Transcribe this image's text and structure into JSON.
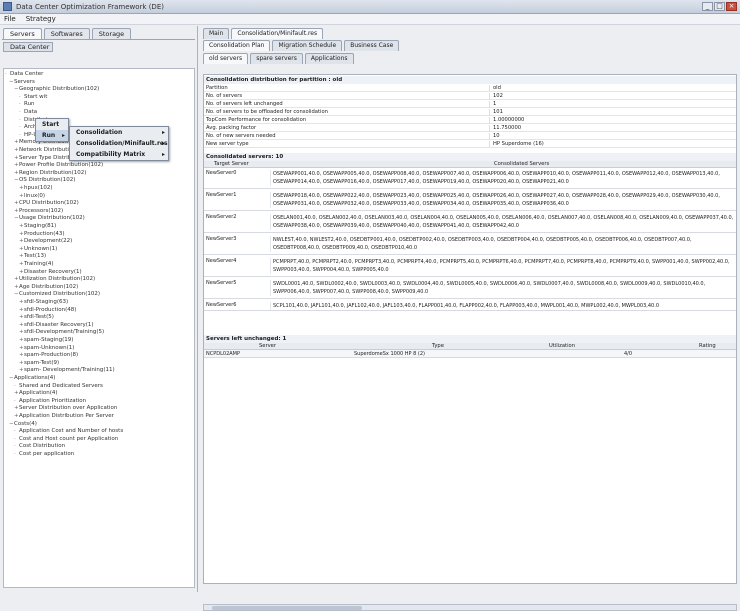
{
  "window": {
    "title": "Data Center Optimization Framework (DE)"
  },
  "menu": [
    "File",
    "Strategy"
  ],
  "left_tabs": [
    "Servers",
    "Softwares",
    "Storage"
  ],
  "data_center_button": "Data Center",
  "tree": [
    {
      "label": "Data Center",
      "lvl": 0
    },
    {
      "label": "Servers",
      "lvl": 1,
      "tog": "−"
    },
    {
      "label": "Geographic Distribution(102)",
      "lvl": 2,
      "tog": "−"
    },
    {
      "label": "Start wit",
      "lvl": 3
    },
    {
      "label": "Run",
      "lvl": 3
    },
    {
      "label": "Data",
      "lvl": 3
    },
    {
      "label": "Distribut",
      "lvl": 3
    },
    {
      "label": "Architec",
      "lvl": 3
    },
    {
      "label": "HP-UX(1",
      "lvl": 3
    },
    {
      "label": "Memory Distribution(102)",
      "lvl": 2,
      "tog": "+"
    },
    {
      "label": "Network Distribution(102)",
      "lvl": 2,
      "tog": "+"
    },
    {
      "label": "Server Type Distribution(102)",
      "lvl": 2,
      "tog": "+"
    },
    {
      "label": "Power Profile Distribution(102)",
      "lvl": 2,
      "tog": "+"
    },
    {
      "label": "Region Distribution(102)",
      "lvl": 2,
      "tog": "+"
    },
    {
      "label": "OS Distribution(102)",
      "lvl": 2,
      "tog": "−"
    },
    {
      "label": "hpux(102)",
      "lvl": 3,
      "tog": "+"
    },
    {
      "label": "linux(0)",
      "lvl": 3,
      "tog": "+"
    },
    {
      "label": "CPU Distribution(102)",
      "lvl": 2,
      "tog": "+"
    },
    {
      "label": "Processors(102)",
      "lvl": 2,
      "tog": "+"
    },
    {
      "label": "Usage Distribution(102)",
      "lvl": 2,
      "tog": "−"
    },
    {
      "label": "Staging(81)",
      "lvl": 3,
      "tog": "+"
    },
    {
      "label": "Production(43)",
      "lvl": 3,
      "tog": "+"
    },
    {
      "label": "Development(22)",
      "lvl": 3,
      "tog": "+"
    },
    {
      "label": "Unknown(1)",
      "lvl": 3,
      "tog": "+"
    },
    {
      "label": "Test(13)",
      "lvl": 3,
      "tog": "+"
    },
    {
      "label": "Training(4)",
      "lvl": 3,
      "tog": "+"
    },
    {
      "label": "Disaster Recovery(1)",
      "lvl": 3,
      "tog": "+"
    },
    {
      "label": "Utilization Distribution(102)",
      "lvl": 2,
      "tog": "+"
    },
    {
      "label": "Age Distribution(102)",
      "lvl": 2,
      "tog": "+"
    },
    {
      "label": "Customized Distribution(102)",
      "lvl": 2,
      "tog": "−"
    },
    {
      "label": "sfdl-Staging(63)",
      "lvl": 3,
      "tog": "+"
    },
    {
      "label": "sfdl-Production(48)",
      "lvl": 3,
      "tog": "+"
    },
    {
      "label": "sfdl-Test(5)",
      "lvl": 3,
      "tog": "+"
    },
    {
      "label": "sfdl-Disaster Recovery(1)",
      "lvl": 3,
      "tog": "+"
    },
    {
      "label": "sfdl-Development/Training(5)",
      "lvl": 3,
      "tog": "+"
    },
    {
      "label": "spam-Staging(19)",
      "lvl": 3,
      "tog": "+"
    },
    {
      "label": "spam-Unknown(1)",
      "lvl": 3,
      "tog": "+"
    },
    {
      "label": "spam-Production(8)",
      "lvl": 3,
      "tog": "+"
    },
    {
      "label": "spam-Test(9)",
      "lvl": 3,
      "tog": "+"
    },
    {
      "label": "spam- Development/Training(11)",
      "lvl": 3,
      "tog": "+"
    },
    {
      "label": "Applications(4)",
      "lvl": 1,
      "tog": "−"
    },
    {
      "label": "Shared and Dedicated Servers",
      "lvl": 2
    },
    {
      "label": "Application(4)",
      "lvl": 2,
      "tog": "+"
    },
    {
      "label": "Application Prioritization",
      "lvl": 2
    },
    {
      "label": "Server Distribution over Application",
      "lvl": 2,
      "tog": "+"
    },
    {
      "label": "Application Distribution Per Server",
      "lvl": 2,
      "tog": "+"
    },
    {
      "label": "Costs(4)",
      "lvl": 1,
      "tog": "−"
    },
    {
      "label": "Application Cost and Number of hosts",
      "lvl": 2
    },
    {
      "label": "Cost and Host count per Application",
      "lvl": 2
    },
    {
      "label": "Cost Distribution",
      "lvl": 2
    },
    {
      "label": "Cost per application",
      "lvl": 2
    }
  ],
  "context_menu": {
    "partial": "Start wit",
    "items": [
      "Run"
    ]
  },
  "submenu": {
    "items": [
      "Consolidation",
      "Consolidation/Minifault.res",
      "Compatibility Matrix"
    ]
  },
  "right_tabs": [
    "Main",
    "Consolidation/Minifault.res"
  ],
  "sub_tabs": [
    "Consolidation Plan",
    "Migration Schedule",
    "Business Case"
  ],
  "sub_tabs2": [
    "old servers",
    "spare servers",
    "Applications"
  ],
  "dist_title": "Consolidation distribution for partition : old",
  "props": [
    {
      "k": "Partition",
      "v": "old"
    },
    {
      "k": "No. of servers",
      "v": "102"
    },
    {
      "k": "No. of servers left unchanged",
      "v": "1"
    },
    {
      "k": "No. of servers to be offloaded for consolidation",
      "v": "101"
    },
    {
      "k": "TopCom Performance for consolidation",
      "v": "1.00000000"
    },
    {
      "k": "Avg. packing factor",
      "v": "11.750000"
    },
    {
      "k": "No. of new servers needed",
      "v": "10"
    },
    {
      "k": "New server type",
      "v": "HP Superdome (16)"
    }
  ],
  "consolidated_title": "Consolidated servers: 10",
  "cols": [
    "Target Server",
    "Consolidated Servers"
  ],
  "servers": [
    {
      "name": "NewServer0",
      "members": "OSEWAPP001,40.0, OSEWAPP005,40.0, OSEWAPP008,40.0, OSEWAPP007,40.0, OSEWAPP006,40.0, OSEWAPP010,40.0, OSEWAPP011,40.0, OSEWAPP012,40.0, OSEWAPP013,40.0, OSEWAPP014,40.0, OSEWAPP016,40.0, OSEWAPP017,40.0, OSEWAPP019,40.0, OSEWAPP020,40.0, OSEWAPP021,40.0"
    },
    {
      "name": "NewServer1",
      "members": "OSEWAPP018,40.0, OSEWAPP022,40.0, OSEWAPP023,40.0, OSEWAPP025,40.0, OSEWAPP026,40.0, OSEWAPP027,40.0, OSEWAPP028,40.0, OSEWAPP029,40.0, OSEWAPP030,40.0, OSEWAPP031,40.0, OSEWAPP032,40.0, OSEWAPP033,40.0, OSEWAPP034,40.0, OSEWAPP035,40.0, OSEWAPP036,40.0"
    },
    {
      "name": "NewServer2",
      "members": "OSELAN001,40.0, OSELAN002,40.0, OSELAN003,40.0, OSELAN004,40.0, OSELAN005,40.0, OSELAN006,40.0, OSELAN007,40.0, OSELAN008,40.0, OSELAN009,40.0, OSEWAPP037,40.0, OSEWAPP038,40.0, OSEWAPP039,40.0, OSEWAPP040,40.0, OSEWAPP041,40.0, OSEWAPP042,40.0"
    },
    {
      "name": "NewServer3",
      "members": "NWLEST,40.0, NWLEST2,40.0, OSEDBTP001,40.0, OSEDBTP002,40.0, OSEDBTP003,40.0, OSEDBTP004,40.0, OSEDBTP005,40.0, OSEDBTP006,40.0, OSEDBTP007,40.0, OSEDBTP008,40.0, OSEDBTP009,40.0, OSEDBTP010,40.0"
    },
    {
      "name": "NewServer4",
      "members": "PCMPRPT,40.0, PCMPRPT2,40.0, PCMPRPT3,40.0, PCMPRPT4,40.0, PCMPRPT5,40.0, PCMPRPT6,40.0, PCMPRPT7,40.0, PCMPRPT8,40.0, PCMPRPT9,40.0, SWPP001,40.0, SWPP002,40.0, SWPP003,40.0, SWPP004,40.0, SWPP005,40.0"
    },
    {
      "name": "NewServer5",
      "members": "SWDL0001,40.0, SWDL0002,40.0, SWDL0003,40.0, SWDL0004,40.0, SWDL0005,40.0, SWDL0006,40.0, SWDL0007,40.0, SWDL0008,40.0, SWDL0009,40.0, SWDL0010,40.0, SWPP006,40.0, SWPP007,40.0, SWPP008,40.0, SWPP009,40.0"
    },
    {
      "name": "NewServer6",
      "members": "SCPL101,40.0, JAFL101,40.0, JAFL102,40.0, JAFL103,40.0, FLAPP001,40.0, FLAPP002,40.0, FLAPP003,40.0, MWPL001,40.0, MWPL002,40.0, MWPL003,40.0"
    }
  ],
  "unchanged_title": "Servers left unchanged: 1",
  "unchanged_cols": [
    "Server",
    "Type",
    "Utilization",
    "Rating"
  ],
  "unchanged_row": {
    "server": "NCPDL02AMP",
    "type": "SuperdomeSx 1000 HP 8 (2)",
    "util": "4/0",
    "rating": ""
  }
}
